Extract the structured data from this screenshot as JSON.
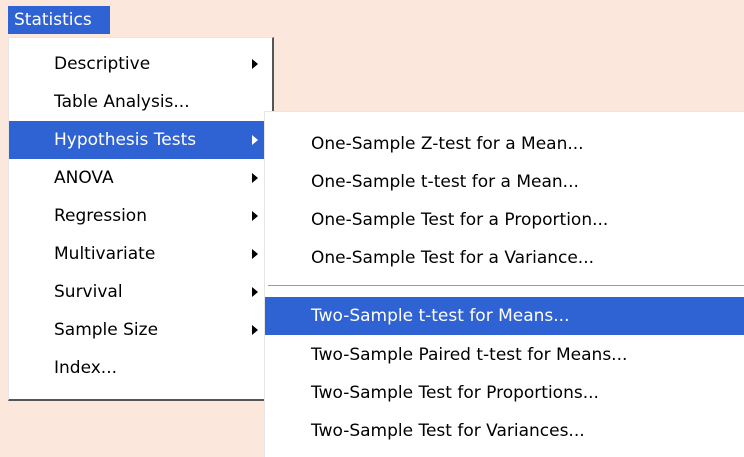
{
  "menubar": {
    "statistics": "Statistics"
  },
  "main_menu": [
    {
      "label": "Descriptive",
      "submenu": true
    },
    {
      "label": "Table Analysis...",
      "submenu": false
    },
    {
      "label": "Hypothesis Tests",
      "submenu": true,
      "selected": true
    },
    {
      "label": "ANOVA",
      "submenu": true
    },
    {
      "label": "Regression",
      "submenu": true
    },
    {
      "label": "Multivariate",
      "submenu": true
    },
    {
      "label": "Survival",
      "submenu": true
    },
    {
      "label": "Sample Size",
      "submenu": true
    },
    {
      "label": "Index...",
      "submenu": false
    }
  ],
  "sub_menu": [
    {
      "label": "One-Sample Z-test for a Mean..."
    },
    {
      "label": "One-Sample t-test for a Mean..."
    },
    {
      "label": "One-Sample Test for a Proportion..."
    },
    {
      "label": "One-Sample Test for a Variance..."
    },
    {
      "label": "Two-Sample t-test for Means...",
      "selected": true
    },
    {
      "label": "Two-Sample Paired t-test for Means..."
    },
    {
      "label": "Two-Sample Test for Proportions..."
    },
    {
      "label": "Two-Sample Test for Variances..."
    }
  ],
  "colors": {
    "highlight": "#2f62d3",
    "background": "#fbe7dc"
  }
}
